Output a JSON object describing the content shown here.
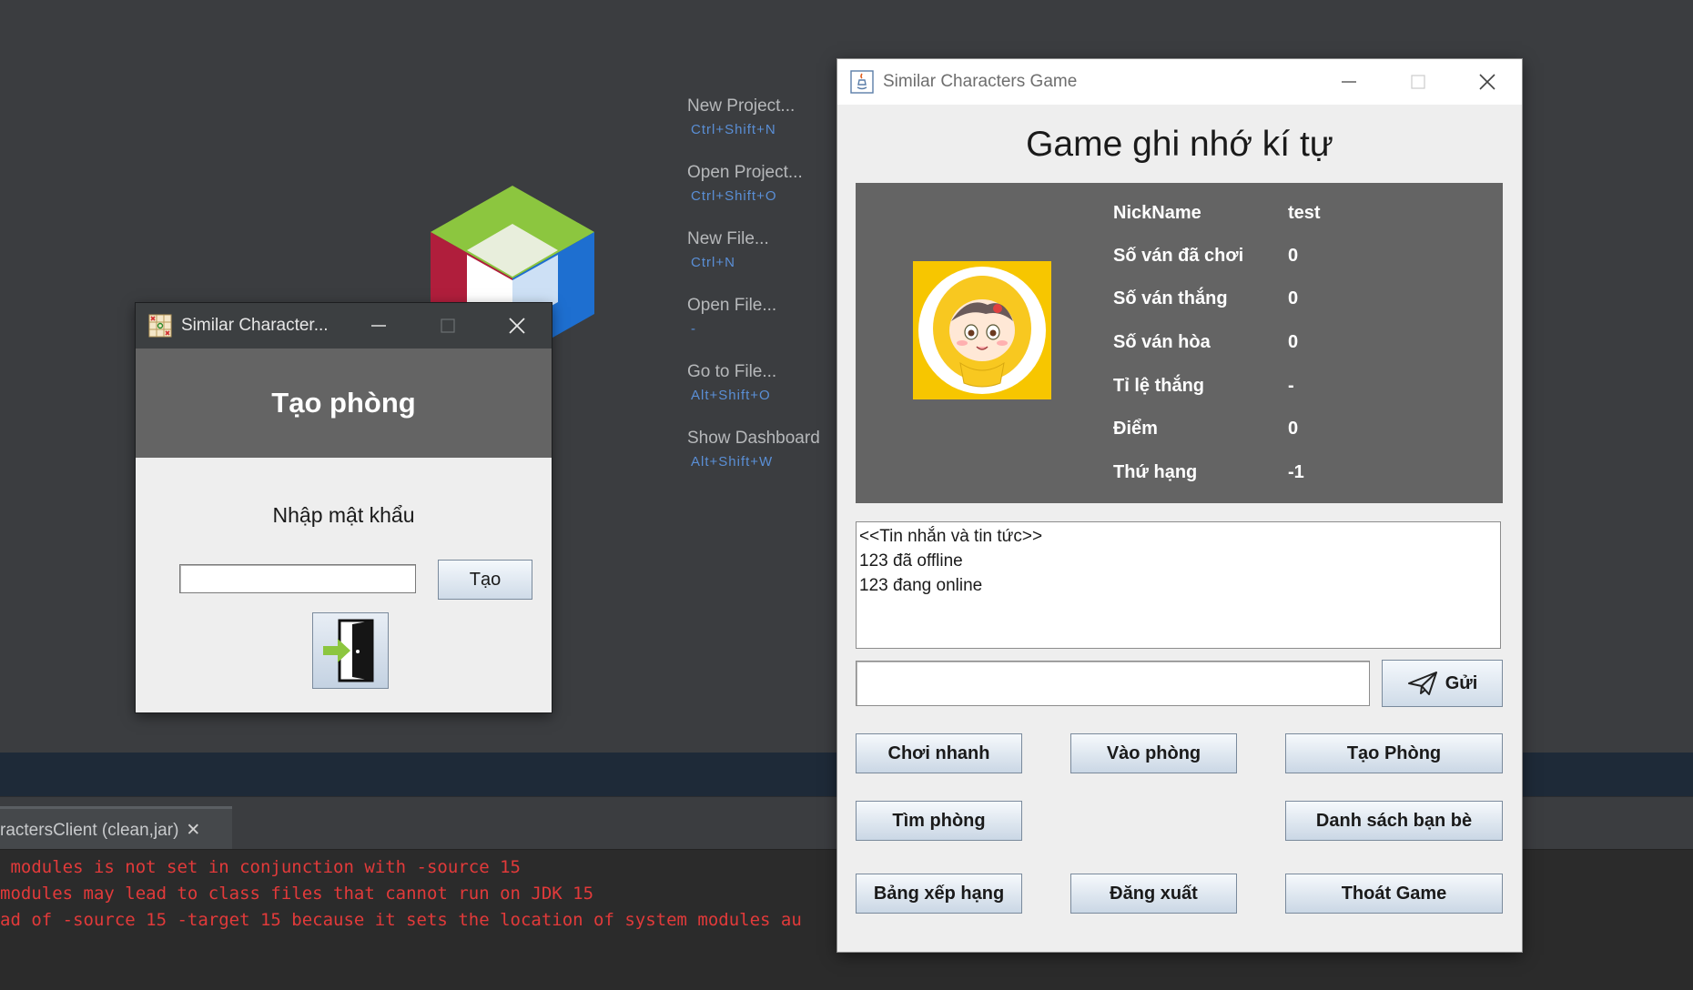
{
  "ide": {
    "menu": [
      {
        "label": "New Project...",
        "shortcut": "Ctrl+Shift+N"
      },
      {
        "label": "Open Project...",
        "shortcut": "Ctrl+Shift+O"
      },
      {
        "label": "New File...",
        "shortcut": "Ctrl+N"
      },
      {
        "label": "Open File...",
        "shortcut": "-"
      },
      {
        "label": "Go to File...",
        "shortcut": "Alt+Shift+O"
      },
      {
        "label": "Show Dashboard",
        "shortcut": "Alt+Shift+W"
      }
    ],
    "output_tab": "ractersClient (clean,jar)",
    "console": [
      " modules is not set in conjunction with -source 15",
      "modules may lead to class files that cannot run on JDK 15",
      "ad of -source 15 -target 15 because it sets the location of system modules au"
    ]
  },
  "create_room_window": {
    "title": "Similar Character...",
    "heading": "Tạo phòng",
    "password_label": "Nhập mật khẩu",
    "password_value": "",
    "create_button": "Tạo"
  },
  "main_window": {
    "title": "Similar Characters Game",
    "heading": "Game ghi nhớ kí tự",
    "profile": [
      {
        "label": "NickName",
        "value": "test"
      },
      {
        "label": "Số ván đã chơi",
        "value": "0"
      },
      {
        "label": "Số ván thắng",
        "value": "0"
      },
      {
        "label": "Số ván hòa",
        "value": "0"
      },
      {
        "label": "Tỉ lệ thắng",
        "value": "-"
      },
      {
        "label": "Điểm",
        "value": "0"
      },
      {
        "label": "Thứ hạng",
        "value": "-1"
      }
    ],
    "messages": [
      "<<Tin nhắn và tin tức>>",
      "123 đã offline",
      "123 đang online"
    ],
    "message_input": "",
    "send_button": "Gửi",
    "buttons": {
      "quick_play": "Chơi nhanh",
      "join_room": "Vào phòng",
      "create_room": "Tạo Phòng",
      "find_room": "Tìm phòng",
      "friends": "Danh sách bạn bè",
      "leaderboard": "Bảng xếp hạng",
      "logout": "Đăng xuất",
      "quit": "Thoát Game"
    }
  },
  "colors": {
    "ide_bg": "#3b3d40",
    "panel_gray": "#646464",
    "shortcut_blue": "#5a8fd6",
    "console_red": "#e23a3a"
  }
}
